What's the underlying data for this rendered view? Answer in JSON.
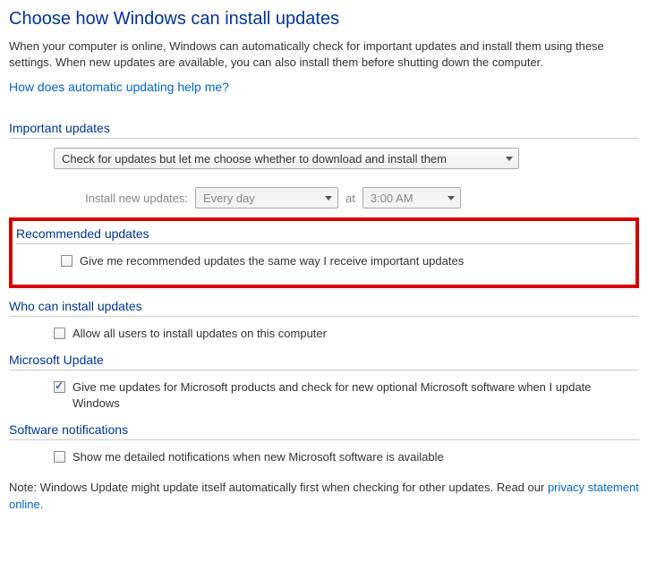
{
  "title": "Choose how Windows can install updates",
  "description": "When your computer is online, Windows can automatically check for important updates and install them using these settings. When new updates are available, you can also install them before shutting down the computer.",
  "help_link": "How does automatic updating help me?",
  "sections": {
    "important": {
      "header": "Important updates",
      "dropdown_value": "Check for updates but let me choose whether to download and install them",
      "schedule_label": "Install new updates:",
      "day_value": "Every day",
      "at_label": "at",
      "time_value": "3:00 AM"
    },
    "recommended": {
      "header": "Recommended updates",
      "checkbox_label": "Give me recommended updates the same way I receive important updates"
    },
    "who": {
      "header": "Who can install updates",
      "checkbox_label": "Allow all users to install updates on this computer"
    },
    "ms_update": {
      "header": "Microsoft Update",
      "checkbox_label": "Give me updates for Microsoft products and check for new optional Microsoft software when I update Windows"
    },
    "notifications": {
      "header": "Software notifications",
      "checkbox_label": "Show me detailed notifications when new Microsoft software is available"
    }
  },
  "note_prefix": "Note: Windows Update might update itself automatically first when checking for other updates.  Read our ",
  "note_link": "privacy statement online",
  "note_suffix": "."
}
